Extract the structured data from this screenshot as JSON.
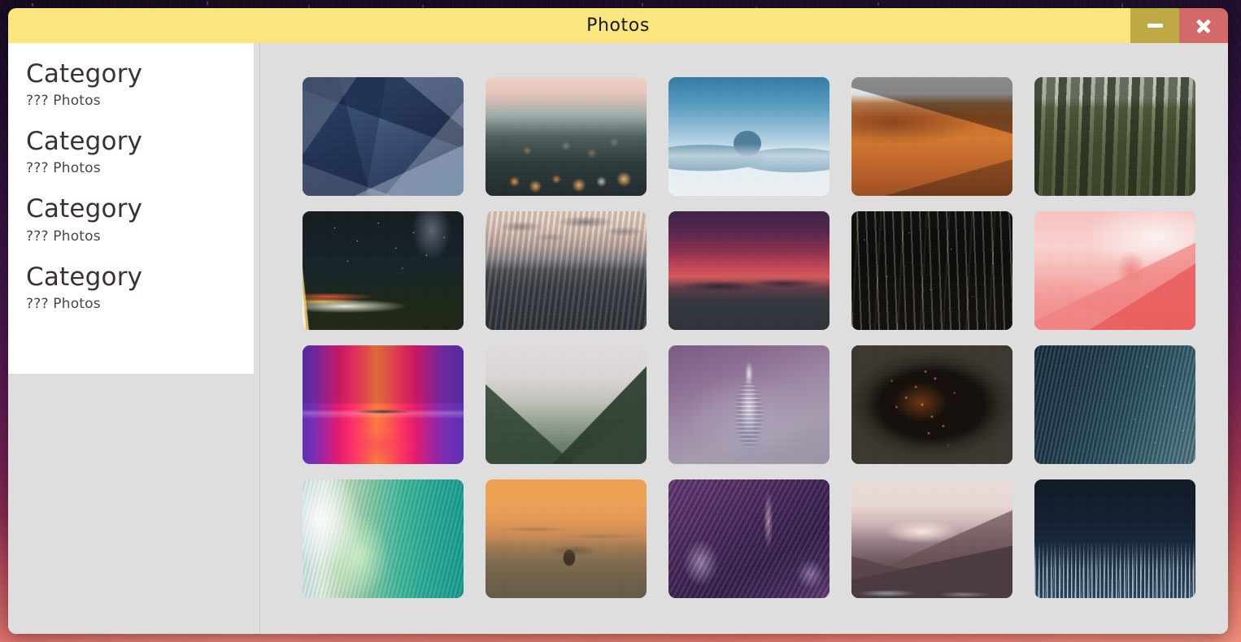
{
  "window": {
    "title": "Photos",
    "titlebar_color": "#fae57e",
    "minimize_color": "#bfa945",
    "close_color": "#d4696a",
    "controls": {
      "minimize_label": "Minimize",
      "minimize_icon": "minimize-icon",
      "close_label": "Close",
      "close_icon": "close-icon"
    }
  },
  "sidebar": {
    "background": "#ffffff",
    "categories": [
      {
        "title": "Category",
        "count": "??? Photos"
      },
      {
        "title": "Category",
        "count": "??? Photos"
      },
      {
        "title": "Category",
        "count": "??? Photos"
      },
      {
        "title": "Category",
        "count": "??? Photos"
      }
    ]
  },
  "content": {
    "background": "#dededf",
    "grid_columns": 5,
    "photos": [
      {
        "name": "photo-low-poly-blue",
        "alt": "Blue low-poly geometric pattern",
        "art": "art-lowpoly"
      },
      {
        "name": "photo-bokeh-city-lights",
        "alt": "Blurred orange bokeh city lights",
        "art": "art-bokeh"
      },
      {
        "name": "photo-misty-blue-mountains",
        "alt": "Misty blue layered mountain peaks",
        "art": "art-mistmountain"
      },
      {
        "name": "photo-desert-dunes",
        "alt": "Orange sand dunes in desert",
        "art": "art-desert"
      },
      {
        "name": "photo-mossy-rock-pillars",
        "alt": "Moss covered rock pillars",
        "art": "art-pillars"
      },
      {
        "name": "photo-night-road-milkyway",
        "alt": "Night highway light trails under the milky way",
        "art": "art-nightroad"
      },
      {
        "name": "photo-stormy-ocean",
        "alt": "Dark choppy ocean under pale sky",
        "art": "art-stormsea"
      },
      {
        "name": "photo-red-purple-sunset",
        "alt": "Red and purple sunset above clouds",
        "art": "art-redsunset"
      },
      {
        "name": "photo-snowy-forest",
        "alt": "Snow dusted dark pine forest",
        "art": "art-snowforest"
      },
      {
        "name": "photo-pink-mountains",
        "alt": "Pink and red layered mountain ridges",
        "art": "art-pinkmountain"
      },
      {
        "name": "photo-neon-corridor",
        "alt": "Neon pink and purple lit corridor",
        "art": "art-neon"
      },
      {
        "name": "photo-green-mountain-peak",
        "alt": "Green misty mountain ridge peak",
        "art": "art-greenpeak"
      },
      {
        "name": "photo-foggy-skyscraper",
        "alt": "Purple fog around a lit skyscraper spire",
        "art": "art-tower"
      },
      {
        "name": "photo-plane-window-city",
        "alt": "City lights at night from airplane window",
        "art": "art-planelights"
      },
      {
        "name": "photo-dark-blue-sea",
        "alt": "Dark blue rippled sea surface",
        "art": "art-bluesea"
      },
      {
        "name": "photo-turquoise-wave",
        "alt": "Turquoise and green breaking wave",
        "art": "art-wave"
      },
      {
        "name": "photo-balloon-sunset",
        "alt": "Hot air balloon in orange sunset haze",
        "art": "art-balloon"
      },
      {
        "name": "photo-purple-canyon-road",
        "alt": "Purple canyon with winding lit road",
        "art": "art-canyon"
      },
      {
        "name": "photo-mountain-lake-sunset",
        "alt": "Mountain range and lake at sunset",
        "art": "art-lakesunset"
      },
      {
        "name": "photo-dark-snow-forest",
        "alt": "Snow covered forest under dark blue sky",
        "art": "art-darkforest"
      }
    ]
  }
}
